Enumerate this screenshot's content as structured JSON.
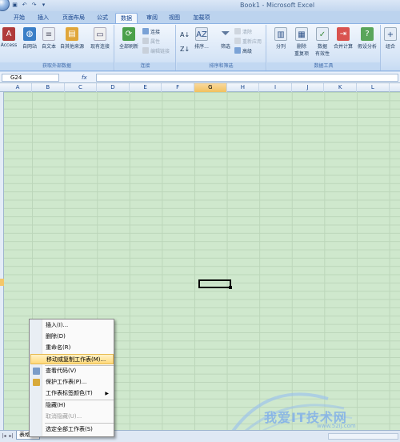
{
  "window": {
    "title": "Book1 - Microsoft Excel"
  },
  "qat": {
    "save_icon": "floppy-icon",
    "undo_icon": "undo-icon",
    "redo_icon": "redo-icon"
  },
  "tabs": [
    {
      "label": "开始",
      "active": false
    },
    {
      "label": "插入",
      "active": false
    },
    {
      "label": "页面布局",
      "active": false
    },
    {
      "label": "公式",
      "active": false
    },
    {
      "label": "数据",
      "active": true
    },
    {
      "label": "审阅",
      "active": false
    },
    {
      "label": "视图",
      "active": false
    },
    {
      "label": "加载项",
      "active": false
    }
  ],
  "ribbon": {
    "get_external": {
      "label": "获取外部数据",
      "buttons": [
        "Access",
        "自网站",
        "自文本",
        "自其他来源",
        "现有连接"
      ]
    },
    "connections": {
      "label": "连接",
      "refresh_all": "全部刷新",
      "small": [
        "连接",
        "属性",
        "编辑链接"
      ]
    },
    "sort_filter": {
      "label": "排序和筛选",
      "sort": "排序...",
      "filter": "筛选",
      "small": [
        "清除",
        "重新应用",
        "高级"
      ]
    },
    "data_tools": {
      "label": "数据工具",
      "buttons": [
        "分列",
        "删除\n重复项",
        "数据\n有效性",
        "合并计算",
        "假设分析"
      ]
    },
    "outline": {
      "buttons": [
        "组合"
      ]
    }
  },
  "formula_bar": {
    "name_box": "G24",
    "fx": "fx",
    "value": ""
  },
  "columns": [
    "A",
    "B",
    "C",
    "D",
    "E",
    "F",
    "G",
    "H",
    "I",
    "J",
    "K",
    "L"
  ],
  "selected_column": "G",
  "sheet": {
    "tab_label": "表格"
  },
  "context_menu": {
    "items": [
      {
        "label": "插入(I)...",
        "state": "normal",
        "icon": ""
      },
      {
        "label": "删除(D)",
        "state": "normal",
        "icon": ""
      },
      {
        "label": "重命名(R)",
        "state": "normal",
        "icon": ""
      },
      {
        "label": "移动或复制工作表(M)...",
        "state": "highlighted",
        "icon": ""
      },
      {
        "label": "查看代码(V)",
        "state": "normal",
        "icon": "code-icon"
      },
      {
        "label": "保护工作表(P)...",
        "state": "normal",
        "icon": "protect-icon"
      },
      {
        "label": "工作表标签颜色(T)",
        "state": "normal",
        "icon": "",
        "submenu": true
      },
      {
        "label": "隐藏(H)",
        "state": "normal",
        "icon": ""
      },
      {
        "label": "取消隐藏(U)...",
        "state": "disabled",
        "icon": ""
      },
      {
        "label": "选定全部工作表(S)",
        "state": "normal",
        "icon": ""
      }
    ]
  },
  "watermark": {
    "text": "我爱IT技术网",
    "url": "www.52ij.com"
  }
}
